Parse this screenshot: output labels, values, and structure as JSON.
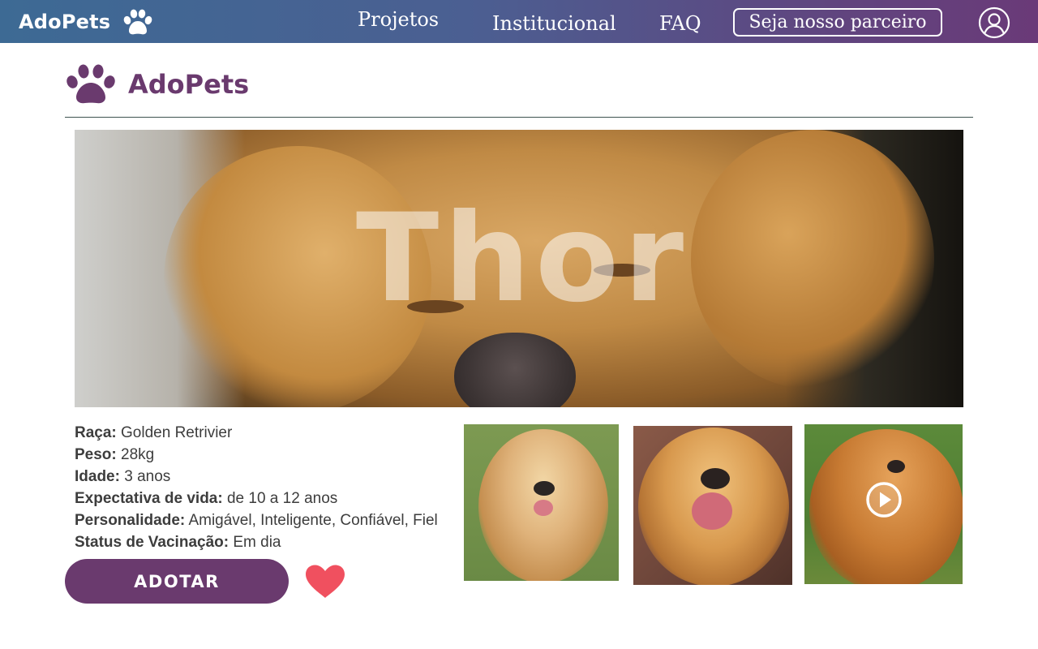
{
  "topnav": {
    "brand": "AdoPets",
    "links": [
      "Projetos",
      "Institucional",
      "FAQ"
    ],
    "partner_button": "Seja nosso parceiro"
  },
  "page_header": {
    "logo_text": "AdoPets"
  },
  "pet": {
    "name": "Thor",
    "details": [
      {
        "label": "Raça:",
        "value": "Golden Retrivier"
      },
      {
        "label": "Peso:",
        "value": "28kg"
      },
      {
        "label": "Idade:",
        "value": "3 anos"
      },
      {
        "label": "Expectativa de vida:",
        "value": "de 10 a 12 anos"
      },
      {
        "label": "Personalidade:",
        "value": "Amigável, Inteligente, Confiável, Fiel"
      },
      {
        "label": "Status de Vacinação:",
        "value": "Em dia"
      }
    ],
    "adopt_button": "ADOTAR"
  },
  "icons": {
    "brand_paw": "paw-icon",
    "logo_paw": "paw-icon",
    "user": "user-circle-icon",
    "favorite": "heart-icon",
    "video": "play-circle-icon"
  },
  "colors": {
    "nav_gradient_start": "#3d6a94",
    "nav_gradient_end": "#6a3a78",
    "brand_purple": "#6a3a6e",
    "heart": "#f0505f",
    "divider": "#3e5350"
  }
}
